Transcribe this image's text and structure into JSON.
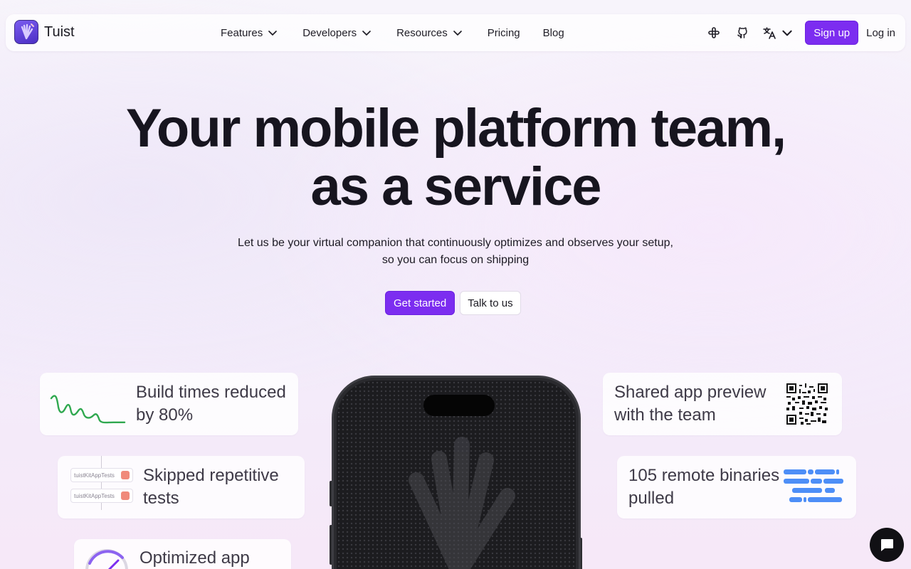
{
  "nav": {
    "brand": "Tuist",
    "menu": [
      {
        "label": "Features",
        "dropdown": true
      },
      {
        "label": "Developers",
        "dropdown": true
      },
      {
        "label": "Resources",
        "dropdown": true
      },
      {
        "label": "Pricing",
        "dropdown": false
      },
      {
        "label": "Blog",
        "dropdown": false
      }
    ],
    "icons": [
      "slack-icon",
      "github-icon",
      "translate-icon"
    ],
    "signup": "Sign up",
    "login": "Log in"
  },
  "hero": {
    "title_line1": "Your mobile platform team,",
    "title_line2": "as a service",
    "subtitle": "Let us be your virtual companion that continuously optimizes and observes your setup, so you can focus on shipping",
    "primary_cta": "Get started",
    "secondary_cta": "Talk to us"
  },
  "features": {
    "build_times": "Build times reduced by 80%",
    "skipped_tests": "Skipped repetitive tests",
    "test_label_1": "tuistKitAppTests",
    "test_label_2": "tuistKitAppTests",
    "optimized_app": "Optimized app",
    "shared_preview": "Shared app preview with the team",
    "remote_binaries": "105 remote binaries pulled"
  },
  "colors": {
    "accent": "#7c2df0",
    "chart_green": "#2fa84f",
    "binary_blue": "#4d8ef7"
  }
}
